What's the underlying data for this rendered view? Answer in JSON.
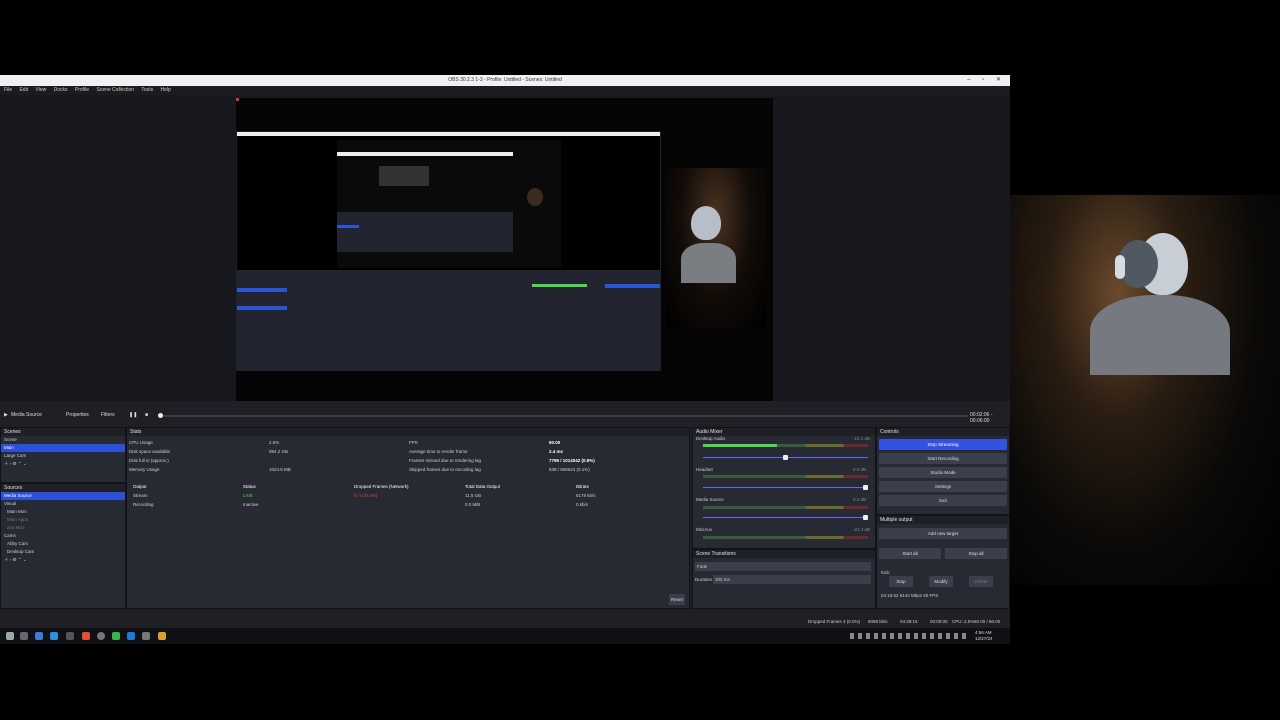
{
  "window": {
    "title": "OBS 30.2.3 1-3 - Profile: Untitled - Scenes: Untitled",
    "controls": "– ▫ ✕"
  },
  "menu": [
    "File",
    "Edit",
    "View",
    "Docks",
    "Profile",
    "Scene Collection",
    "Tools",
    "Help"
  ],
  "player": {
    "source": "Media Source",
    "properties": "Properties",
    "filters": "Filters",
    "time": "00:02:06 - 00:06:00"
  },
  "scenes": {
    "header": "Scenes",
    "items": [
      "Scene",
      "Main",
      "Large Cam"
    ],
    "selected": 1
  },
  "sources": {
    "header": "Sources",
    "items": [
      "Media Source",
      "Visual",
      "Main Mon",
      "Main Apps",
      "2nd Mon",
      "Cams",
      "Abby Cam",
      "Desktop Cam"
    ],
    "selected": 0
  },
  "stats": {
    "header": "Stats",
    "left": [
      [
        "CPU Usage",
        "2.5%"
      ],
      [
        "Disk space available",
        "984.2 GB"
      ],
      [
        "Disk full in (approx.)",
        ""
      ],
      [
        "Memory Usage",
        "1024.5 MB"
      ]
    ],
    "right": [
      [
        "FPS",
        "60.00"
      ],
      [
        "Average time to render frame",
        "2.4 ms"
      ],
      [
        "Frames missed due to rendering lag",
        "7798 / 1014042 (0.8%)"
      ],
      [
        "Skipped frames due to encoding lag",
        "838 / 968624 (0.1%)"
      ]
    ],
    "table_headers": [
      "Output",
      "Status",
      "Dropped Frames (Network)",
      "Total Data Output",
      "Bitrate"
    ],
    "rows": [
      [
        "Stream",
        "LIVE",
        "0 / 0 (0.0%)",
        "11.5 GB",
        "6178 kb/s"
      ],
      [
        "Recording",
        "Inactive",
        "",
        "0.0 MiB",
        "0 kb/s"
      ]
    ],
    "reset": "Reset"
  },
  "audio": {
    "header": "Audio Mixer",
    "channels": [
      {
        "name": "Desktop Audio",
        "db": "-10.1 dB",
        "level": 0.45,
        "volume": 0.5
      },
      {
        "name": "Headset",
        "db": "0.0 dB",
        "level": 0.0,
        "volume": 1.0
      },
      {
        "name": "Media Source",
        "db": "0.0 dB",
        "level": 0.0,
        "volume": 1.0
      },
      {
        "name": "Mic/Aux",
        "db": "-21.4 dB",
        "level": 0.0,
        "volume": 1.0
      }
    ]
  },
  "transitions": {
    "header": "Scene Transitions",
    "type": "Fade",
    "duration_label": "Duration",
    "duration": "300 ms"
  },
  "controls": {
    "header": "Controls",
    "buttons": [
      "Stop Streaming",
      "Start Recording",
      "Studio Mode",
      "Settings",
      "Exit"
    ]
  },
  "multi": {
    "header": "Multiple output",
    "add": "Add new target",
    "start_all": "Start all",
    "stop_all": "Stop all",
    "target": "Kick",
    "stop": "Stop",
    "modify": "Modify",
    "delete": "Delete",
    "target_status": "04:16:52 6144 Mbps 60 FPS"
  },
  "status": {
    "dropped": "Dropped Frames 4 (0.0%)",
    "bitrate": "6088 kb/s",
    "live": "04:28:15",
    "rec": "00:00:00",
    "cpu": "CPU: 2.5%",
    "fps": "60.00 / 60.00 FPS"
  },
  "clock": {
    "time": "4:56 AM",
    "date": "12/27/24"
  }
}
